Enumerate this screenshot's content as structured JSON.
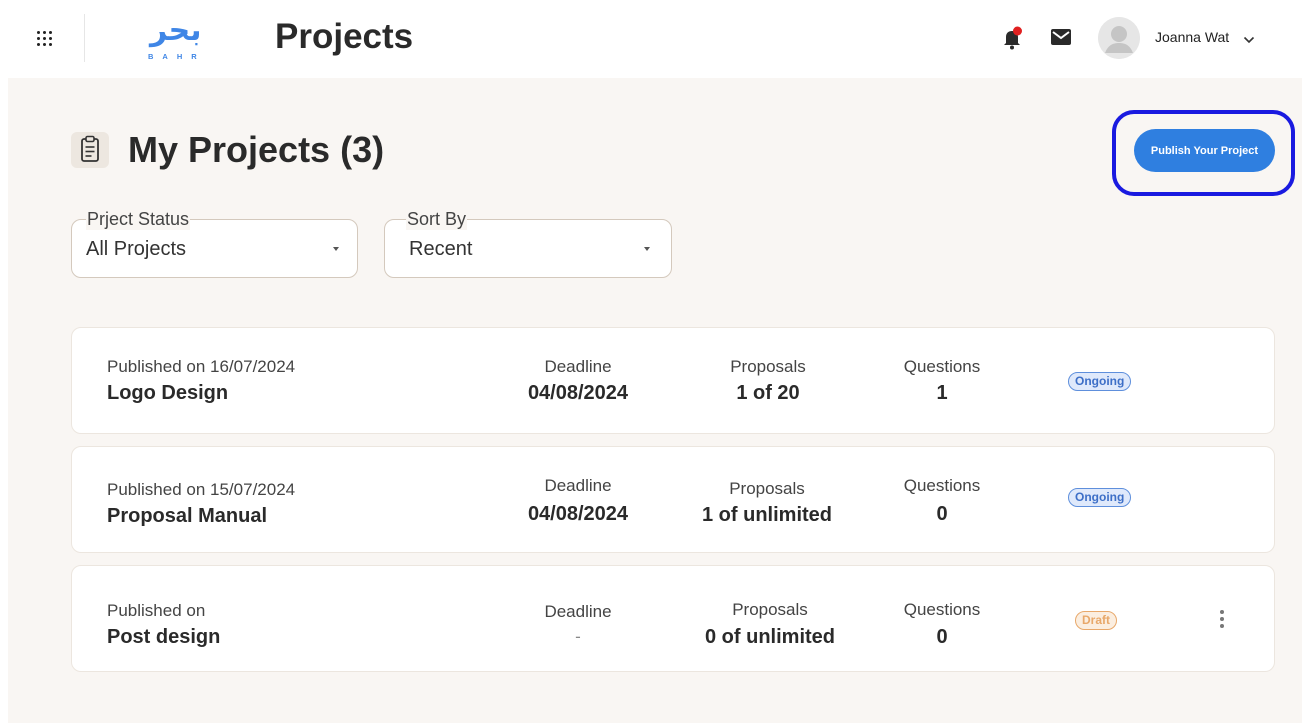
{
  "header": {
    "title": "Projects",
    "logo_arabic": "بحر",
    "logo_latin": "BAHR",
    "user_name": "Joanna Wat",
    "icons": {
      "apps": "apps-grid-icon",
      "notifications": "bell-icon",
      "messages": "mail-icon",
      "avatar": "user-avatar-icon",
      "user_menu": "chevron-down-icon"
    }
  },
  "main": {
    "section_title": "My Projects (3)",
    "section_icon": "clipboard-icon",
    "publish_label": "Publish Your Project",
    "filters": {
      "status": {
        "legend": "Prject Status",
        "value": "All Projects"
      },
      "sort": {
        "legend": "Sort By",
        "value": "Recent"
      }
    },
    "projects": [
      {
        "published": "Published on 16/07/2024",
        "name": "Logo Design",
        "deadline_label": "Deadline",
        "deadline": "04/08/2024",
        "proposals_label": "Proposals",
        "proposals": "1 of 20",
        "questions_label": "Questions",
        "questions": "1",
        "status": "Ongoing"
      },
      {
        "published": "Published on 15/07/2024",
        "name": "Proposal Manual",
        "deadline_label": "Deadline",
        "deadline": "04/08/2024",
        "proposals_label": "Proposals",
        "proposals": "1 of unlimited",
        "questions_label": "Questions",
        "questions": "0",
        "status": "Ongoing"
      },
      {
        "published": "Published on",
        "name": "Post design",
        "deadline_label": "Deadline",
        "deadline": "-",
        "proposals_label": "Proposals",
        "proposals": "0 of unlimited",
        "questions_label": "Questions",
        "questions": "0",
        "status": "Draft"
      }
    ]
  },
  "colors": {
    "brand_blue": "#2f7fe0",
    "highlight_ring": "#1a1ae0",
    "page_background": "#f9f6f3",
    "ongoing": "#3d6fc7",
    "draft": "#e8a86a",
    "notification_dot": "#e02020"
  }
}
